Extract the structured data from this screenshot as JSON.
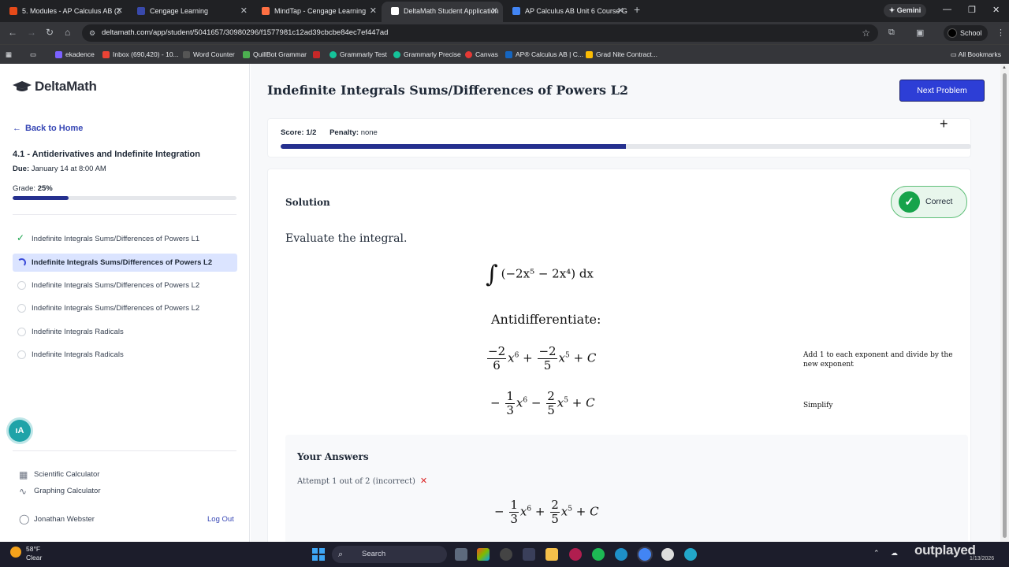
{
  "browser": {
    "tabs": [
      {
        "title": "5. Modules - AP Calculus AB (2",
        "color": "#e64a19"
      },
      {
        "title": "Cengage Learning",
        "color": "#3949ab"
      },
      {
        "title": "MindTap - Cengage Learning",
        "color": "#ff7043"
      },
      {
        "title": "DeltaMath Student Application",
        "color": "#ffffff"
      },
      {
        "title": "AP Calculus AB Unit 6 Course G",
        "color": "#4285f4"
      }
    ],
    "gemini_label": "Gemini",
    "url": "deltamath.com/app/student/5041657/30980296/f1577981c12ad39cbcbe84ec7ef447ad",
    "profile_label": "School",
    "bookmarks": [
      {
        "label": "ekadence",
        "color": "#7b61ff"
      },
      {
        "label": "Inbox (690,420) - 10...",
        "color": "#ea4335"
      },
      {
        "label": "Word Counter",
        "color": "#333333"
      },
      {
        "label": "QuillBot Grammar",
        "color": "#4caf50"
      },
      {
        "label": "",
        "color": "#c62828"
      },
      {
        "label": "Grammarly Test",
        "color": "#15c39a"
      },
      {
        "label": "Grammarly Precise",
        "color": "#15c39a"
      },
      {
        "label": "Canvas",
        "color": "#e53935"
      },
      {
        "label": "AP® Calculus AB | C...",
        "color": "#1565c0"
      },
      {
        "label": "Grad Nite Contract...",
        "color": "#fbbc04"
      }
    ],
    "all_bookmarks_label": "All Bookmarks"
  },
  "sidebar": {
    "logo_text": "DeltaMath",
    "back_label": "Back to Home",
    "assignment_title": "4.1 - Antiderivatives and Indefinite Integration",
    "due_label": "Due:",
    "due_value": "January 14 at 8:00 AM",
    "grade_label": "Grade:",
    "grade_value": "25%",
    "grade_fraction": 0.25,
    "problems": [
      {
        "label": "Indefinite Integrals Sums/Differences of Powers L1",
        "status": "done"
      },
      {
        "label": "Indefinite Integrals Sums/Differences of Powers L2",
        "status": "current"
      },
      {
        "label": "Indefinite Integrals Sums/Differences of Powers L2",
        "status": "todo"
      },
      {
        "label": "Indefinite Integrals Sums/Differences of Powers L2",
        "status": "todo"
      },
      {
        "label": "Indefinite Integrals Radicals",
        "status": "todo"
      },
      {
        "label": "Indefinite Integrals Radicals",
        "status": "todo"
      }
    ],
    "scientific_calc_label": "Scientific Calculator",
    "graphing_calc_label": "Graphing Calculator",
    "user_name": "Jonathan Webster",
    "logout_label": "Log Out"
  },
  "main": {
    "problem_title": "Indefinite Integrals Sums/Differences of Powers L2",
    "next_button_label": "Next Problem",
    "score_label": "Score:",
    "score_value": "1/2",
    "penalty_label": "Penalty:",
    "penalty_value": "none",
    "score_fraction": 0.5,
    "solution_heading": "Solution",
    "correct_label": "Correct",
    "prompt": "Evaluate the integral.",
    "integral_expr": "(−2x⁵ − 2x⁴) dx",
    "antidiff_label": "Antidifferentiate:",
    "step1_note": "Add 1 to each exponent and divide by the new exponent",
    "step2_note": "Simplify",
    "answers_heading": "Your Answers",
    "attempt_text": "Attempt 1 out of 2 (incorrect)"
  },
  "taskbar": {
    "temperature": "58°F",
    "weather": "Clear",
    "search_label": "Search",
    "watermark": "outplayed",
    "date": "1/13/2026"
  }
}
